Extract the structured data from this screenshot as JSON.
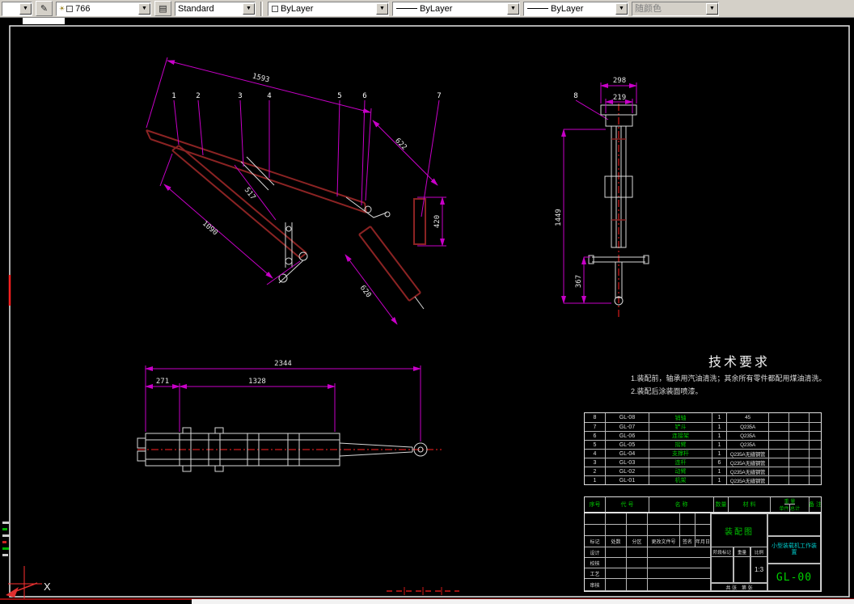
{
  "toolbar": {
    "layer_combo": {
      "value": "766"
    },
    "style_combo": {
      "value": "Standard"
    },
    "color_combo": {
      "value": "ByLayer"
    },
    "linetype_combo": {
      "value": "ByLayer"
    },
    "lineweight_combo": {
      "value": "ByLayer"
    },
    "plotstyle_combo": {
      "value": "随颜色"
    }
  },
  "canvas": {
    "ucs_axis_label": "X",
    "balloons": [
      "1",
      "2",
      "3",
      "4",
      "5",
      "6",
      "7",
      "8"
    ],
    "dims": {
      "boom_length": "1593",
      "link_622": "622",
      "link_517": "517",
      "frame_1090": "1090",
      "height_420": "420",
      "cyl_620": "620",
      "side_width_298": "298",
      "side_width_219": "219",
      "side_height_1449": "1449",
      "side_height_367": "367",
      "plan_length_2344": "2344",
      "plan_271": "271",
      "plan_1328": "1328"
    },
    "tech_req": {
      "title": "技术要求",
      "line1": "1.装配前，轴承用汽油清洗；其余所有零件都配用煤油清洗。",
      "line2": "2.装配后涂装面喷漆。"
    }
  },
  "bom": {
    "header": {
      "no": "序号",
      "code": "代  号",
      "name": "名  称",
      "qty": "数量",
      "material": "材  料",
      "weight": "重 量",
      "unit": "单件",
      "total": "总计",
      "remark": "备 注"
    },
    "rows": [
      {
        "no": "8",
        "code": "GL-08",
        "name": "销轴",
        "qty": "1",
        "material": "45"
      },
      {
        "no": "7",
        "code": "GL-07",
        "name": "铲斗",
        "qty": "1",
        "material": "Q235A"
      },
      {
        "no": "6",
        "code": "GL-06",
        "name": "连接架",
        "qty": "1",
        "material": "Q235A"
      },
      {
        "no": "5",
        "code": "GL-05",
        "name": "摇臂",
        "qty": "1",
        "material": "Q235A"
      },
      {
        "no": "4",
        "code": "GL-04",
        "name": "支撑杆",
        "qty": "1",
        "material": "Q235A无缝钢管"
      },
      {
        "no": "3",
        "code": "GL-03",
        "name": "连杆",
        "qty": "6",
        "material": "Q235A无缝钢管"
      },
      {
        "no": "2",
        "code": "GL-02",
        "name": "动臂",
        "qty": "1",
        "material": "Q235A无缝钢管"
      },
      {
        "no": "1",
        "code": "GL-01",
        "name": "机架",
        "qty": "1",
        "material": "Q235A无缝钢管"
      }
    ]
  },
  "titleblock": {
    "labels": {
      "mark": "标记",
      "count": "处数",
      "zone": "分区",
      "change_file": "更改文件号",
      "sign": "签名",
      "date": "年月日",
      "design": "设计",
      "check": "校核",
      "process": "工艺",
      "approve": "审核",
      "stage": "阶段标记",
      "weight": "重量",
      "scale": "比例",
      "sheets": "共  张",
      "sheet_no": "第  张"
    },
    "drawing_type": "装配图",
    "project_name": "小型装载机工作装置",
    "scale_value": "1:3",
    "drawing_no": "GL-00"
  }
}
